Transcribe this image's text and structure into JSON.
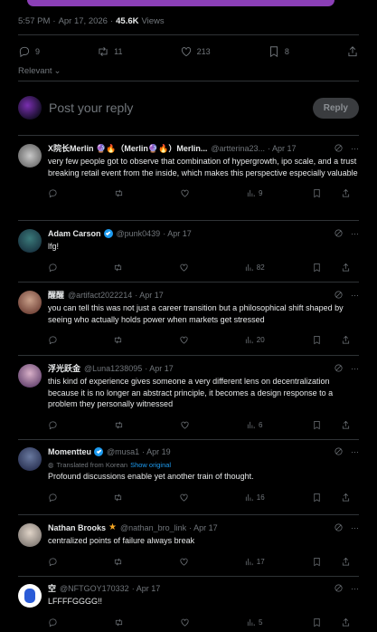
{
  "meta": {
    "time": "5:57 PM",
    "sep": "·",
    "date": "Apr 17, 2026",
    "sep2": "·",
    "views": "45.6K",
    "views_label": "Views"
  },
  "stats": {
    "replies": "9",
    "reposts": "11",
    "likes": "213",
    "bookmarks": "8"
  },
  "sort": {
    "label": "Relevant"
  },
  "reply": {
    "placeholder": "Post your reply",
    "button": "Reply"
  },
  "posts": [
    {
      "name": "X院长Merlin 🔮🔥（Merlin🔮🔥）Merlin...",
      "handle": "@artterina23...",
      "date": "· Apr 17",
      "text": "very few people got to observe that combination of hypergrowth, ipo scale, and a trust breaking retail event from the inside, which makes this perspective especially valuable",
      "views": "9"
    },
    {
      "name": "Adam Carson",
      "handle": "@punk0439",
      "date": "· Apr 17",
      "text": "lfg!",
      "views": "82"
    },
    {
      "name": "醒醒",
      "handle": "@artifact2022214",
      "date": "· Apr 17",
      "text": "you can tell this was not just a career transition but a philosophical shift shaped by seeing who actually holds power when markets get stressed",
      "views": "20"
    },
    {
      "name": "浮光跃金",
      "handle": "@Luna1238095",
      "date": "· Apr 17",
      "text": "this kind of experience gives someone a very different lens on decentralization because it is no longer an abstract principle, it becomes a design response to a problem they personally witnessed",
      "views": "6"
    },
    {
      "name": "Momentteu",
      "handle": "@musa1",
      "date": "· Apr 19",
      "translated": "Translated from Korean",
      "show_original": "Show original",
      "text": "Profound discussions enable yet another train of thought.",
      "views": "16"
    },
    {
      "name": "Nathan Brooks",
      "handle": "@nathan_bro_link",
      "date": "· Apr 17",
      "text": "centralized points of failure always break",
      "views": "17"
    },
    {
      "name": "空",
      "handle": "@NFTGOY170332",
      "date": "· Apr 17",
      "text": "LFFFFGGGG!!",
      "views": "5"
    }
  ]
}
